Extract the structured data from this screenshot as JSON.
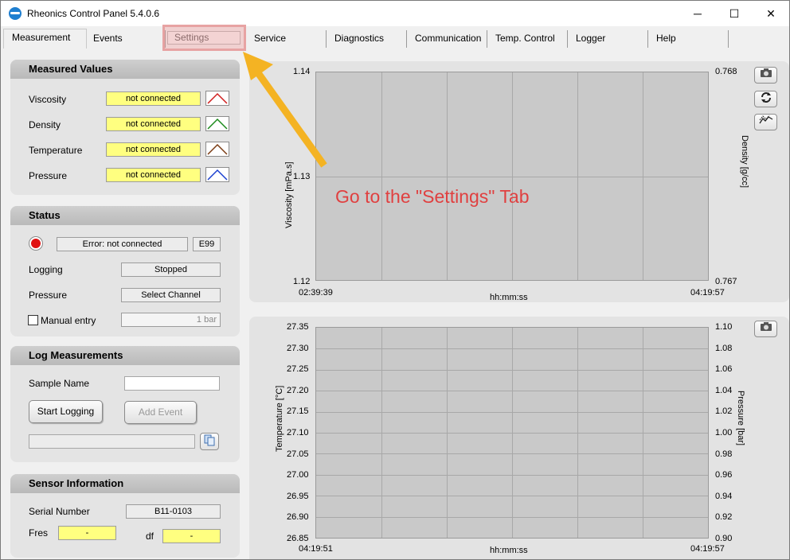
{
  "window": {
    "title": "Rheonics Control Panel 5.4.0.6",
    "minimize": "─",
    "maximize": "☐",
    "close": "✕"
  },
  "tabs": [
    "Measurement",
    "Events",
    "Settings",
    "Service",
    "Diagnostics",
    "Communication",
    "Temp. Control",
    "Logger",
    "Help"
  ],
  "measured": {
    "title": "Measured Values",
    "rows": [
      {
        "label": "Viscosity",
        "value": "not connected",
        "color": "#d02020"
      },
      {
        "label": "Density",
        "value": "not connected",
        "color": "#1a8a1a"
      },
      {
        "label": "Temperature",
        "value": "not connected",
        "color": "#7a3b12"
      },
      {
        "label": "Pressure",
        "value": "not connected",
        "color": "#1a3fd0"
      }
    ]
  },
  "status": {
    "title": "Status",
    "error": "Error: not connected",
    "code": "E99",
    "logging_label": "Logging",
    "logging_value": "Stopped",
    "pressure_label": "Pressure",
    "pressure_value": "Select Channel",
    "manual_label": "Manual entry",
    "manual_value": "1 bar"
  },
  "log": {
    "title": "Log Measurements",
    "sample_label": "Sample Name",
    "start": "Start Logging",
    "add": "Add Event"
  },
  "sensor": {
    "title": "Sensor Information",
    "serial_label": "Serial Number",
    "serial": "B11-0103",
    "fres_label": "Fres",
    "fres": "-",
    "df_label": "df",
    "df": "-"
  },
  "chart_data": [
    {
      "type": "line",
      "ylabel": "Viscosity [mPa.s]",
      "y2label": "Density [g/cc]",
      "xlabel": "hh:mm:ss",
      "y_ticks": [
        "1.14",
        "1.13",
        "1.12"
      ],
      "y2_ticks": [
        "0.768",
        "0.767"
      ],
      "x_ticks": [
        "02:39:39",
        "04:19:57"
      ],
      "ylim": [
        1.12,
        1.14
      ],
      "y2lim": [
        0.767,
        0.768
      ]
    },
    {
      "type": "line",
      "ylabel": "Temperature [°C]",
      "y2label": "Pressure [bar]",
      "xlabel": "hh:mm:ss",
      "y_ticks": [
        "27.35",
        "27.30",
        "27.25",
        "27.20",
        "27.15",
        "27.10",
        "27.05",
        "27.00",
        "26.95",
        "26.90",
        "26.85"
      ],
      "y2_ticks": [
        "1.10",
        "1.08",
        "1.06",
        "1.04",
        "1.02",
        "1.00",
        "0.98",
        "0.96",
        "0.94",
        "0.92",
        "0.90"
      ],
      "x_ticks": [
        "04:19:51",
        "04:19:57"
      ],
      "ylim": [
        26.85,
        27.35
      ],
      "y2lim": [
        0.9,
        1.1
      ]
    }
  ],
  "annotation": "Go to the \"Settings\" Tab"
}
